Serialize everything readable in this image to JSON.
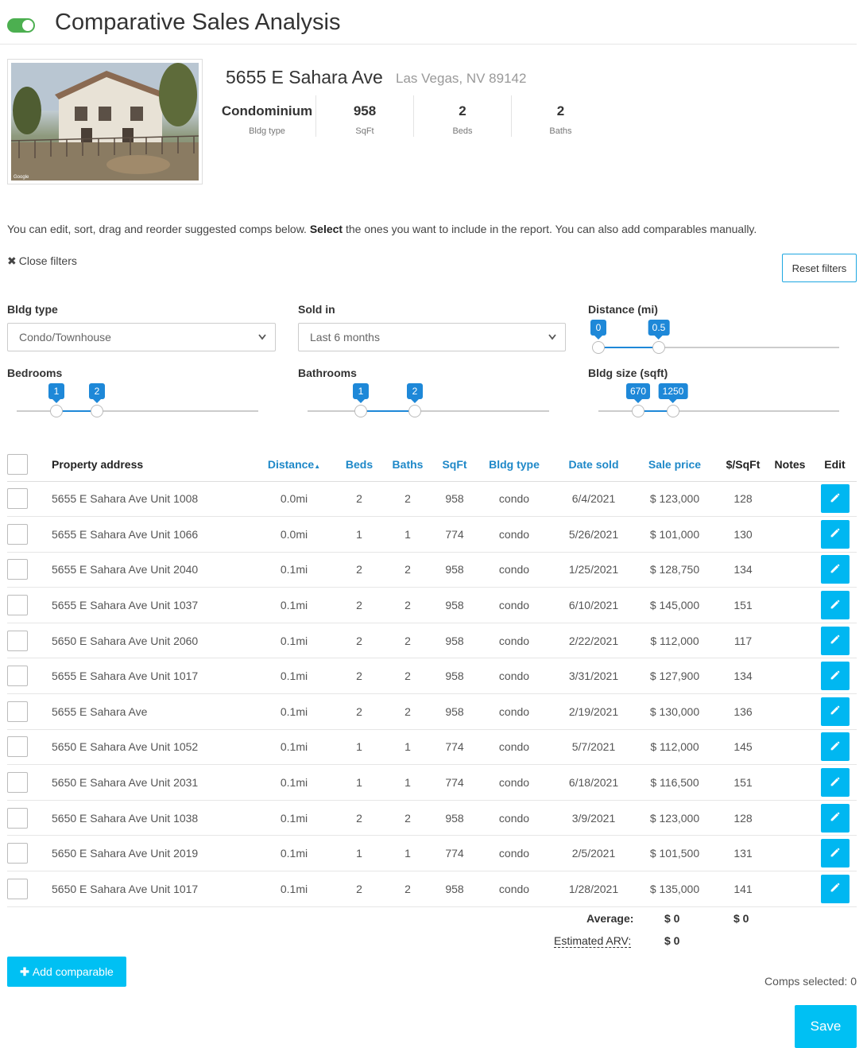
{
  "header": {
    "title": "Comparative Sales Analysis",
    "toggle_on": true,
    "toggle_color": "#4caf50"
  },
  "property": {
    "address": "5655 E Sahara Ave",
    "city": "Las Vegas, NV 89142",
    "photo_caption": "Google",
    "stats": [
      {
        "value": "Condominium",
        "label": "Bldg type"
      },
      {
        "value": "958",
        "label": "SqFt"
      },
      {
        "value": "2",
        "label": "Beds"
      },
      {
        "value": "2",
        "label": "Baths"
      }
    ]
  },
  "instructions": {
    "before": "You can edit, sort, drag and reorder suggested comps below. ",
    "bold": "Select",
    "after": " the ones you want to include in the report. You can also add comparables manually."
  },
  "filters": {
    "close_label": "Close filters",
    "reset_label": "Reset filters",
    "bldg_type": {
      "label": "Bldg type",
      "value": "Condo/Townhouse"
    },
    "sold_in": {
      "label": "Sold in",
      "value": "Last 6 months"
    },
    "distance": {
      "label": "Distance (mi)",
      "min": "0",
      "max": "0.5"
    },
    "bedrooms": {
      "label": "Bedrooms",
      "min": "1",
      "max": "2"
    },
    "bathrooms": {
      "label": "Bathrooms",
      "min": "1",
      "max": "2"
    },
    "bldg_size": {
      "label": "Bldg size (sqft)",
      "min": "670",
      "max": "1250"
    }
  },
  "table": {
    "headers": {
      "address": "Property address",
      "distance": "Distance",
      "beds": "Beds",
      "baths": "Baths",
      "sqft": "SqFt",
      "bldg_type": "Bldg type",
      "date_sold": "Date sold",
      "sale_price": "Sale price",
      "price_sqft": "$/SqFt",
      "notes": "Notes",
      "edit": "Edit"
    },
    "rows": [
      {
        "address": "5655 E Sahara Ave Unit 1008",
        "distance": "0.0mi",
        "beds": "2",
        "baths": "2",
        "sqft": "958",
        "type": "condo",
        "date": "6/4/2021",
        "price": "$ 123,000",
        "ppsf": "128"
      },
      {
        "address": "5655 E Sahara Ave Unit 1066",
        "distance": "0.0mi",
        "beds": "1",
        "baths": "1",
        "sqft": "774",
        "type": "condo",
        "date": "5/26/2021",
        "price": "$ 101,000",
        "ppsf": "130"
      },
      {
        "address": "5655 E Sahara Ave Unit 2040",
        "distance": "0.1mi",
        "beds": "2",
        "baths": "2",
        "sqft": "958",
        "type": "condo",
        "date": "1/25/2021",
        "price": "$ 128,750",
        "ppsf": "134"
      },
      {
        "address": "5655 E Sahara Ave Unit 1037",
        "distance": "0.1mi",
        "beds": "2",
        "baths": "2",
        "sqft": "958",
        "type": "condo",
        "date": "6/10/2021",
        "price": "$ 145,000",
        "ppsf": "151"
      },
      {
        "address": "5650 E Sahara Ave Unit 2060",
        "distance": "0.1mi",
        "beds": "2",
        "baths": "2",
        "sqft": "958",
        "type": "condo",
        "date": "2/22/2021",
        "price": "$ 112,000",
        "ppsf": "117"
      },
      {
        "address": "5655 E Sahara Ave Unit 1017",
        "distance": "0.1mi",
        "beds": "2",
        "baths": "2",
        "sqft": "958",
        "type": "condo",
        "date": "3/31/2021",
        "price": "$ 127,900",
        "ppsf": "134"
      },
      {
        "address": "5655 E Sahara Ave",
        "distance": "0.1mi",
        "beds": "2",
        "baths": "2",
        "sqft": "958",
        "type": "condo",
        "date": "2/19/2021",
        "price": "$ 130,000",
        "ppsf": "136"
      },
      {
        "address": "5650 E Sahara Ave Unit 1052",
        "distance": "0.1mi",
        "beds": "1",
        "baths": "1",
        "sqft": "774",
        "type": "condo",
        "date": "5/7/2021",
        "price": "$ 112,000",
        "ppsf": "145"
      },
      {
        "address": "5650 E Sahara Ave Unit 2031",
        "distance": "0.1mi",
        "beds": "1",
        "baths": "1",
        "sqft": "774",
        "type": "condo",
        "date": "6/18/2021",
        "price": "$ 116,500",
        "ppsf": "151"
      },
      {
        "address": "5650 E Sahara Ave Unit 1038",
        "distance": "0.1mi",
        "beds": "2",
        "baths": "2",
        "sqft": "958",
        "type": "condo",
        "date": "3/9/2021",
        "price": "$ 123,000",
        "ppsf": "128"
      },
      {
        "address": "5650 E Sahara Ave Unit 2019",
        "distance": "0.1mi",
        "beds": "1",
        "baths": "1",
        "sqft": "774",
        "type": "condo",
        "date": "2/5/2021",
        "price": "$ 101,500",
        "ppsf": "131"
      },
      {
        "address": "5650 E Sahara Ave Unit 1017",
        "distance": "0.1mi",
        "beds": "2",
        "baths": "2",
        "sqft": "958",
        "type": "condo",
        "date": "1/28/2021",
        "price": "$ 135,000",
        "ppsf": "141"
      }
    ]
  },
  "summary": {
    "average_label": "Average:",
    "average_price": "$ 0",
    "average_ppsf": "$ 0",
    "arv_label": "Estimated ARV:",
    "arv_value": "$ 0"
  },
  "footer": {
    "add_label": "Add comparable",
    "comps_selected": "Comps selected: 0",
    "save_label": "Save"
  },
  "colors": {
    "accent": "#00c0f3",
    "link": "#1e88c8",
    "slider": "#1e88d8"
  },
  "icons": {
    "toggle": "toggle-switch",
    "close": "close-x-icon",
    "chevron": "chevron-down-icon",
    "sort": "sort-asc-icon",
    "edit": "pencil-icon",
    "add": "plus-icon"
  }
}
